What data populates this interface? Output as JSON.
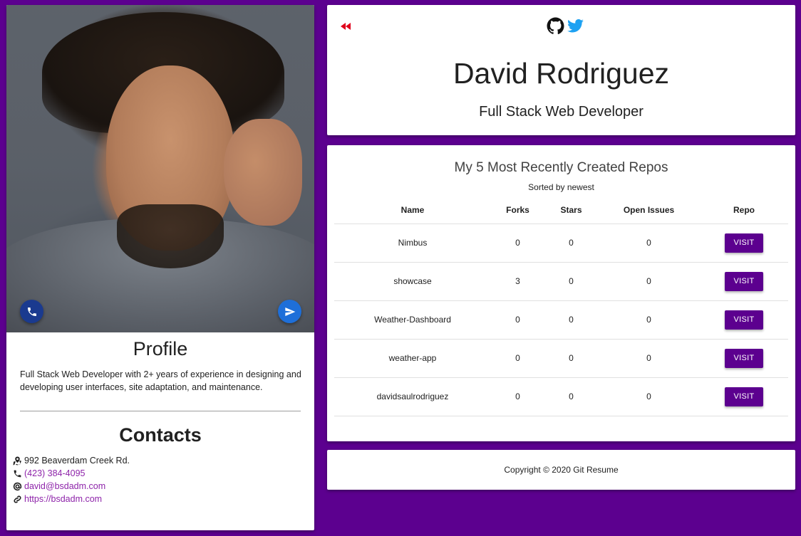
{
  "profile": {
    "heading": "Profile",
    "summary": "Full Stack Web Developer with 2+ years of experience in designing and developing user interfaces, site adaptation, and maintenance."
  },
  "contacts": {
    "heading": "Contacts",
    "address": "992 Beaverdam Creek Rd.",
    "phone": "(423) 384-4095",
    "email": "david@bsdadm.com",
    "website": "https://bsdadm.com"
  },
  "header": {
    "name": "David Rodriguez",
    "title": "Full Stack Web Developer"
  },
  "repos": {
    "title": "My 5 Most Recently Created Repos",
    "subtitle": "Sorted by newest",
    "columns": [
      "Name",
      "Forks",
      "Stars",
      "Open Issues",
      "Repo"
    ],
    "rows": [
      {
        "name": "Nimbus",
        "forks": "0",
        "stars": "0",
        "issues": "0",
        "button": "VISIT"
      },
      {
        "name": "showcase",
        "forks": "3",
        "stars": "0",
        "issues": "0",
        "button": "VISIT"
      },
      {
        "name": "Weather-Dashboard",
        "forks": "0",
        "stars": "0",
        "issues": "0",
        "button": "VISIT"
      },
      {
        "name": "weather-app",
        "forks": "0",
        "stars": "0",
        "issues": "0",
        "button": "VISIT"
      },
      {
        "name": "davidsaulrodriguez",
        "forks": "0",
        "stars": "0",
        "issues": "0",
        "button": "VISIT"
      }
    ]
  },
  "footer": {
    "copyright": "Copyright © 2020 Git Resume"
  },
  "colors": {
    "background": "#5c008f",
    "accent": "#5c008f",
    "link": "#8e24aa",
    "back_icon": "#e0001b",
    "twitter": "#1da1f2"
  },
  "icons": [
    "back-rewind-icon",
    "github-icon",
    "twitter-icon",
    "phone-icon",
    "send-icon",
    "map-icon",
    "phone-small-icon",
    "at-icon",
    "link-icon"
  ]
}
